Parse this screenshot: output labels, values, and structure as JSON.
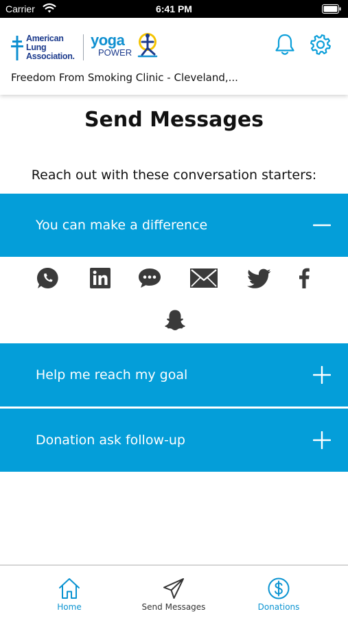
{
  "status_bar": {
    "carrier": "Carrier",
    "time": "6:41 PM"
  },
  "header": {
    "logo_ala_lines": [
      "American",
      "Lung",
      "Association."
    ],
    "logo_yoga": "yoga",
    "logo_power": "POWER",
    "clinic_name": "Freedom From Smoking Clinic - Cleveland,...",
    "icons": [
      "bell-icon",
      "gear-icon"
    ]
  },
  "page": {
    "title": "Send Messages",
    "intro": "Reach out with these conversation starters:"
  },
  "accordion": [
    {
      "label": "You can make a difference",
      "expanded": true
    },
    {
      "label": "Help me reach my goal",
      "expanded": false
    },
    {
      "label": "Donation ask follow-up",
      "expanded": false
    }
  ],
  "share_icons": [
    "whatsapp-icon",
    "linkedin-icon",
    "sms-icon",
    "email-icon",
    "twitter-icon",
    "facebook-icon",
    "snapchat-icon"
  ],
  "tabs": [
    {
      "label": "Home",
      "icon": "home-icon",
      "active": true
    },
    {
      "label": "Send Messages",
      "icon": "send-icon",
      "active": false
    },
    {
      "label": "Donations",
      "icon": "dollar-icon",
      "active": false
    }
  ],
  "colors": {
    "accent": "#049ed9",
    "tab_active": "#0a93d1",
    "brand_navy": "#1b3a8c",
    "icon_dark": "#3a3a3a"
  }
}
